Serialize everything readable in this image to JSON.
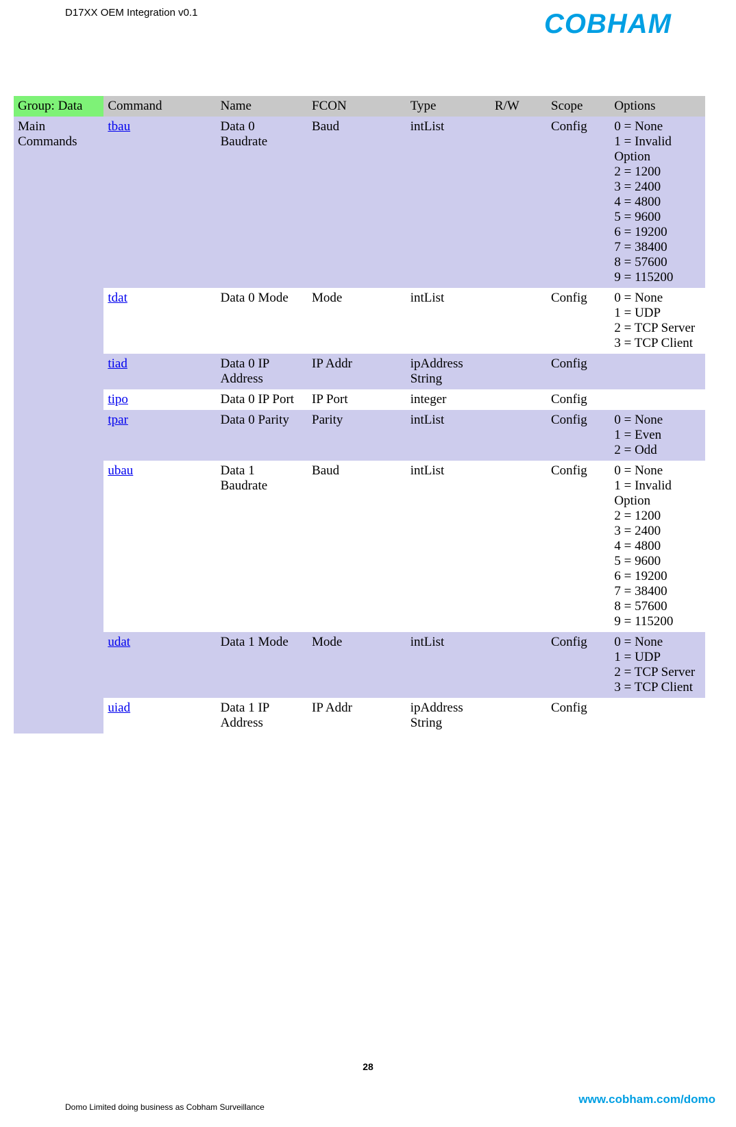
{
  "doc_title": "D17XX OEM Integration v0.1",
  "logo_text": "COBHAM",
  "page_number": "28",
  "footer_left": "Domo Limited doing business as Cobham Surveillance",
  "footer_right": "www.cobham.com/domo",
  "headers": {
    "group": "Group: Data",
    "command": "Command",
    "name": "Name",
    "fcon": "FCON",
    "type": "Type",
    "rw": "R/W",
    "scope": "Scope",
    "options": "Options"
  },
  "row_label": "Main Commands",
  "rows": [
    {
      "command": "tbau",
      "name": "Data 0 Baudrate",
      "fcon": "Baud",
      "type": "intList",
      "rw": "",
      "scope": "Config",
      "options": [
        "0 = None",
        "1 = Invalid Option",
        "2 = 1200",
        "3 = 2400",
        "4 = 4800",
        "5 = 9600",
        "6 = 19200",
        "7 = 38400",
        "8 = 57600",
        "9 = 115200"
      ],
      "shade": true
    },
    {
      "command": "tdat",
      "name": "Data 0 Mode",
      "fcon": "Mode",
      "type": "intList",
      "rw": "",
      "scope": "Config",
      "options": [
        "0 = None",
        "1 = UDP",
        "2 = TCP Server",
        "3 = TCP Client"
      ],
      "shade": false
    },
    {
      "command": "tiad",
      "name": "Data 0 IP Address",
      "fcon": "IP Addr",
      "type": "ipAddress String",
      "rw": "",
      "scope": "Config",
      "options": [],
      "shade": true
    },
    {
      "command": "tipo",
      "name": "Data 0 IP Port",
      "fcon": "IP Port",
      "type": "integer",
      "rw": "",
      "scope": "Config",
      "options": [],
      "shade": false
    },
    {
      "command": "tpar",
      "name": "Data 0 Parity",
      "fcon": "Parity",
      "type": "intList",
      "rw": "",
      "scope": "Config",
      "options": [
        "0 = None",
        "1 = Even",
        "2 = Odd"
      ],
      "shade": true
    },
    {
      "command": "ubau",
      "name": "Data 1 Baudrate",
      "fcon": "Baud",
      "type": "intList",
      "rw": "",
      "scope": "Config",
      "options": [
        "0 = None",
        "1 = Invalid Option",
        "2 = 1200",
        "3 = 2400",
        "4 = 4800",
        "5 = 9600",
        "6 = 19200",
        "7 = 38400",
        "8 = 57600",
        "9 = 115200"
      ],
      "shade": false
    },
    {
      "command": "udat",
      "name": "Data 1 Mode",
      "fcon": "Mode",
      "type": "intList",
      "rw": "",
      "scope": "Config",
      "options": [
        "0 = None",
        "1 = UDP",
        "2 = TCP Server",
        "3 = TCP Client"
      ],
      "shade": true
    },
    {
      "command": "uiad",
      "name": "Data 1 IP Address",
      "fcon": "IP Addr",
      "type": "ipAddress String",
      "rw": "",
      "scope": "Config",
      "options": [],
      "shade": false
    }
  ]
}
